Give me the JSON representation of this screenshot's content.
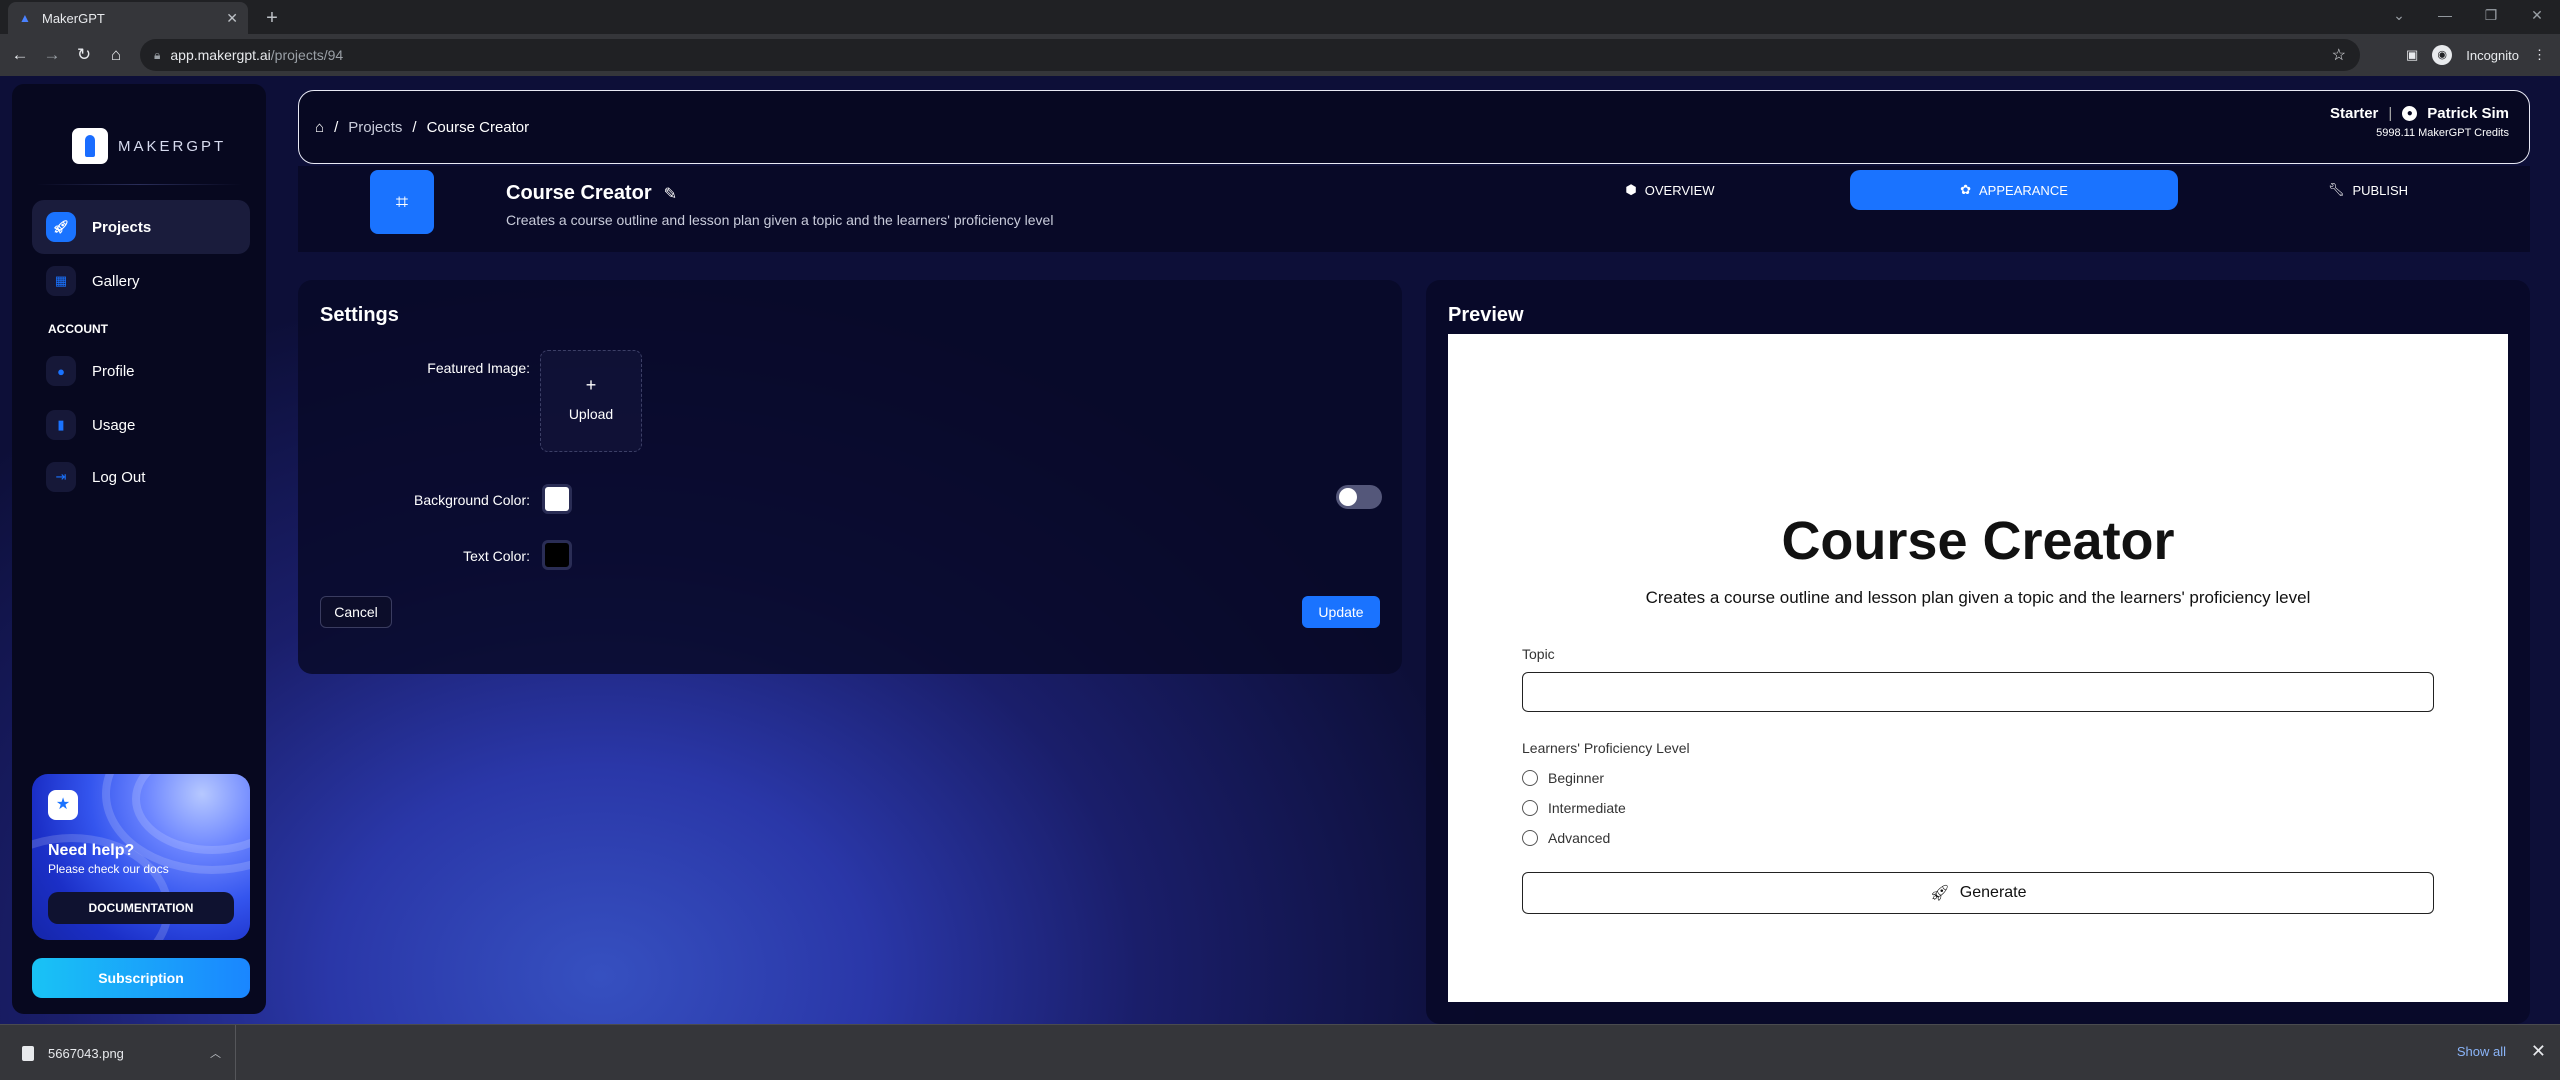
{
  "browser": {
    "tab_title": "MakerGPT",
    "url_host": "app.makergpt.ai",
    "url_path": "/projects/94",
    "profile_label": "Incognito"
  },
  "sidebar": {
    "logo_text": "MAKERGPT",
    "items": [
      {
        "label": "Projects",
        "icon": "rocket-icon",
        "active": true
      },
      {
        "label": "Gallery",
        "icon": "image-icon",
        "active": false
      }
    ],
    "account_section": "ACCOUNT",
    "account_items": [
      {
        "label": "Profile",
        "icon": "user-icon"
      },
      {
        "label": "Usage",
        "icon": "bar-chart-icon"
      },
      {
        "label": "Log Out",
        "icon": "logout-icon"
      }
    ],
    "help": {
      "title": "Need help?",
      "subtitle": "Please check our docs",
      "button": "DOCUMENTATION"
    },
    "subscription_button": "Subscription"
  },
  "breadcrumb": {
    "items": [
      "Projects",
      "Course Creator"
    ]
  },
  "account": {
    "plan": "Starter",
    "user": "Patrick Sim",
    "credits": "5998.11 MakerGPT Credits"
  },
  "project": {
    "title": "Course Creator",
    "description": "Creates a course outline and lesson plan given a topic and the learners' proficiency level",
    "tabs": [
      {
        "label": "OVERVIEW",
        "icon": "cube-icon",
        "active": false
      },
      {
        "label": "APPEARANCE",
        "icon": "palette-icon",
        "active": true
      },
      {
        "label": "PUBLISH",
        "icon": "wrench-icon",
        "active": false
      }
    ]
  },
  "settings": {
    "title": "Settings",
    "featured_image_label": "Featured Image:",
    "upload_label": "Upload",
    "background_color_label": "Background Color:",
    "background_color": "#ffffff",
    "text_color_label": "Text Color:",
    "text_color": "#000000",
    "cancel_label": "Cancel",
    "update_label": "Update"
  },
  "preview": {
    "title": "Preview",
    "app_title": "Course Creator",
    "app_description": "Creates a course outline and lesson plan given a topic and the learners' proficiency level",
    "topic_label": "Topic",
    "proficiency_label": "Learners' Proficiency Level",
    "options": [
      "Beginner",
      "Intermediate",
      "Advanced"
    ],
    "generate_label": "Generate"
  },
  "downloads": {
    "file": "5667043.png",
    "show_all": "Show all"
  },
  "colors": {
    "accent": "#1a73ff",
    "sidebar_bg": "#07081f"
  }
}
